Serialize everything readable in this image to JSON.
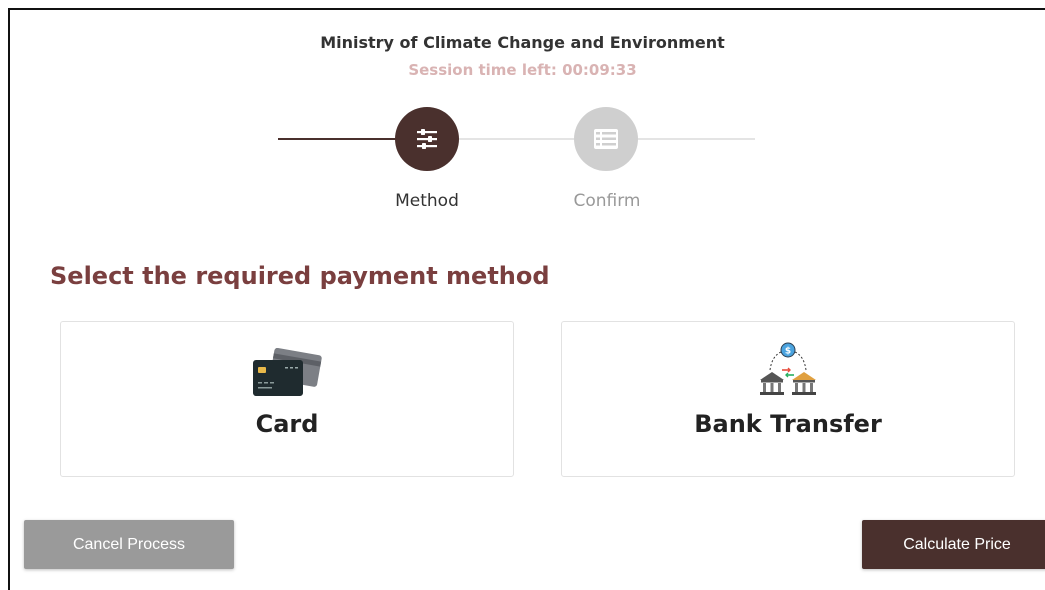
{
  "header": {
    "title": "Ministry of Climate Change and Environment",
    "session": "Session time left: 00:09:33"
  },
  "stepper": {
    "steps": [
      {
        "label": "Method",
        "state": "active",
        "icon": "sliders-icon"
      },
      {
        "label": "Confirm",
        "state": "inactive",
        "icon": "list-icon"
      }
    ]
  },
  "section_title": "Select the required payment method",
  "options": [
    {
      "label": "Card",
      "icon": "credit-card-icon"
    },
    {
      "label": "Bank Transfer",
      "icon": "bank-transfer-icon"
    }
  ],
  "buttons": {
    "cancel": "Cancel Process",
    "calculate": "Calculate Price"
  },
  "colors": {
    "primary": "#4a302d",
    "heading": "#7a3f3f",
    "session": "#d9b3b3",
    "inactive_step": "#cfcfcf",
    "cancel_bg": "#9a9a9a"
  }
}
